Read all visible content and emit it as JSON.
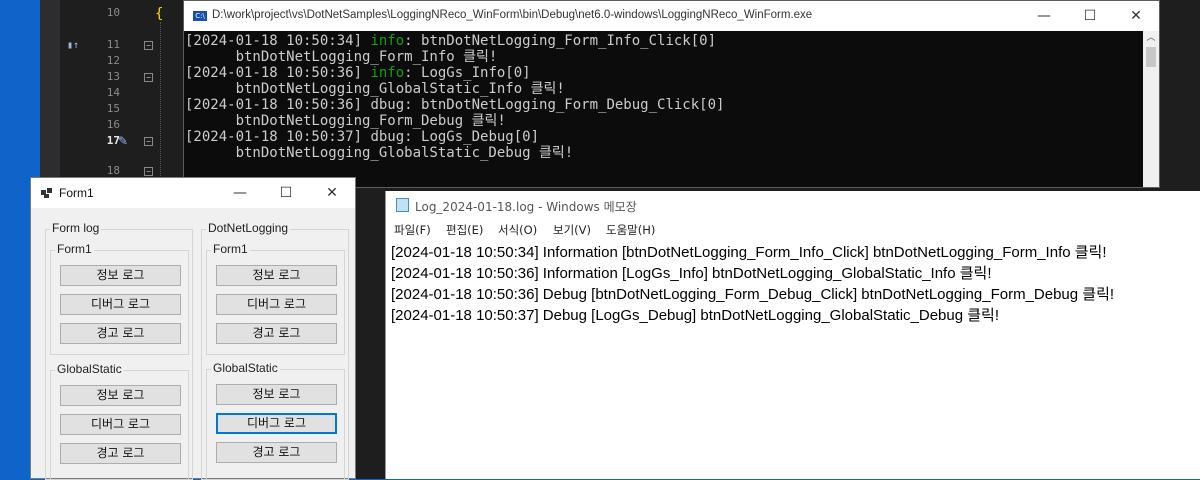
{
  "editor": {
    "line_numbers": [
      "10",
      "11",
      "12",
      "13",
      "14",
      "15",
      "16",
      "17",
      "18"
    ],
    "current_line": "17"
  },
  "console": {
    "title": "D:\\work\\project\\vs\\DotNetSamples\\LoggingNReco_WinForm\\bin\\Debug\\net6.0-windows\\LoggingNReco_WinForm.exe",
    "icon_label": "C:\\",
    "minimize": "—",
    "maximize": "☐",
    "close": "✕",
    "lines": [
      {
        "prefix": "[2024-01-18 10:50:34] ",
        "level": "info",
        "level_class": "info",
        "message": ": btnDotNetLogging_Form_Info_Click[0]"
      },
      {
        "prefix": "      btnDotNetLogging_Form_Info 클릭!",
        "level": "",
        "level_class": "",
        "message": ""
      },
      {
        "prefix": "[2024-01-18 10:50:36] ",
        "level": "info",
        "level_class": "info",
        "message": ": LogGs_Info[0]"
      },
      {
        "prefix": "      btnDotNetLogging_GlobalStatic_Info 클릭!",
        "level": "",
        "level_class": "",
        "message": ""
      },
      {
        "prefix": "[2024-01-18 10:50:36] ",
        "level": "dbug",
        "level_class": "",
        "message": ": btnDotNetLogging_Form_Debug_Click[0]"
      },
      {
        "prefix": "      btnDotNetLogging_Form_Debug 클릭!",
        "level": "",
        "level_class": "",
        "message": ""
      },
      {
        "prefix": "[2024-01-18 10:50:37] ",
        "level": "dbug",
        "level_class": "",
        "message": ": LogGs_Debug[0]"
      },
      {
        "prefix": "      btnDotNetLogging_GlobalStatic_Debug 클릭!",
        "level": "",
        "level_class": "",
        "message": ""
      }
    ]
  },
  "form1": {
    "title": "Form1",
    "minimize": "—",
    "maximize": "☐",
    "close": "✕",
    "groups": {
      "form_log": {
        "label": "Form log",
        "form1": {
          "label": "Form1",
          "buttons": [
            "정보 로그",
            "디버그 로그",
            "경고 로그"
          ]
        },
        "global": {
          "label": "GlobalStatic",
          "buttons": [
            "정보 로그",
            "디버그 로그",
            "경고 로그"
          ]
        }
      },
      "dotnet_logging": {
        "label": "DotNetLogging",
        "form1": {
          "label": "Form1",
          "buttons": [
            "정보 로그",
            "디버그 로그",
            "경고 로그"
          ]
        },
        "global": {
          "label": "GlobalStatic",
          "buttons": [
            "정보 로그",
            "디버그 로그",
            "경고 로그"
          ]
        }
      }
    }
  },
  "notepad": {
    "title": "Log_2024-01-18.log - Windows 메모장",
    "menu": [
      "파일(F)",
      "편집(E)",
      "서식(O)",
      "보기(V)",
      "도움말(H)"
    ],
    "lines": [
      "[2024-01-18 10:50:34] Information [btnDotNetLogging_Form_Info_Click] btnDotNetLogging_Form_Info 클릭!",
      "[2024-01-18 10:50:36] Information [LogGs_Info] btnDotNetLogging_GlobalStatic_Info 클릭!",
      "[2024-01-18 10:50:36] Debug [btnDotNetLogging_Form_Debug_Click] btnDotNetLogging_Form_Debug 클릭!",
      "[2024-01-18 10:50:37] Debug [LogGs_Debug] btnDotNetLogging_GlobalStatic_Debug 클릭!"
    ]
  }
}
